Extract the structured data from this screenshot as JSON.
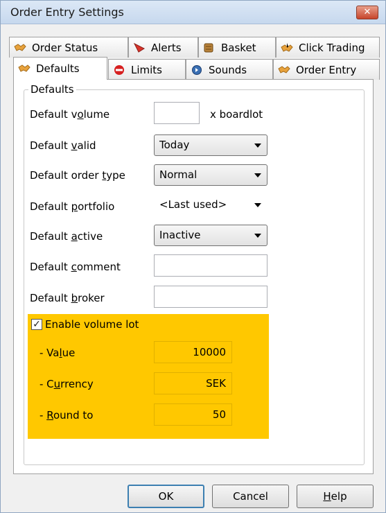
{
  "window": {
    "title": "Order Entry Settings",
    "close_glyph": "✕"
  },
  "tabs_back": [
    {
      "label": "Order Status",
      "icon": "handshake-icon"
    },
    {
      "label": "Alerts",
      "icon": "alert-flag-icon"
    },
    {
      "label": "Basket",
      "icon": "basket-icon"
    },
    {
      "label": "Click Trading",
      "icon": "click-trading-icon"
    }
  ],
  "tabs_front": [
    {
      "label": "Defaults",
      "icon": "handshake-icon",
      "selected": true
    },
    {
      "label": "Limits",
      "icon": "no-entry-icon"
    },
    {
      "label": "Sounds",
      "icon": "sound-icon"
    },
    {
      "label": "Order Entry",
      "icon": "handshake-icon"
    }
  ],
  "defaults": {
    "group_title": "Defaults",
    "volume": {
      "label_pre": "Default v",
      "label_u": "o",
      "label_post": "lume",
      "value": "",
      "suffix": "x boardlot"
    },
    "valid": {
      "label_pre": "Default ",
      "label_u": "v",
      "label_post": "alid",
      "value": "Today"
    },
    "order_type": {
      "label_pre": "Default order ",
      "label_u": "t",
      "label_post": "ype",
      "value": "Normal"
    },
    "portfolio": {
      "label_pre": "Default ",
      "label_u": "p",
      "label_post": "ortfolio",
      "value": "<Last used>"
    },
    "active": {
      "label_pre": "Default ",
      "label_u": "a",
      "label_post": "ctive",
      "value": "Inactive"
    },
    "comment": {
      "label_pre": "Default ",
      "label_u": "c",
      "label_post": "omment",
      "value": ""
    },
    "broker": {
      "label_pre": "Default ",
      "label_u": "b",
      "label_post": "roker",
      "value": ""
    }
  },
  "volume_lot": {
    "enable_label": "Enable volume lot",
    "checked": true,
    "check_glyph": "✓",
    "value": {
      "label_pre": "- Va",
      "label_u": "l",
      "label_post": "ue",
      "value": "10000"
    },
    "currency": {
      "label_pre": "- C",
      "label_u": "u",
      "label_post": "rrency",
      "value": "SEK"
    },
    "round_to": {
      "label_pre": "- ",
      "label_u": "R",
      "label_post": "ound to",
      "value": "50"
    },
    "highlight_color": "#ffc800"
  },
  "buttons": {
    "ok": "OK",
    "cancel": "Cancel",
    "help_u": "H",
    "help_post": "elp"
  }
}
